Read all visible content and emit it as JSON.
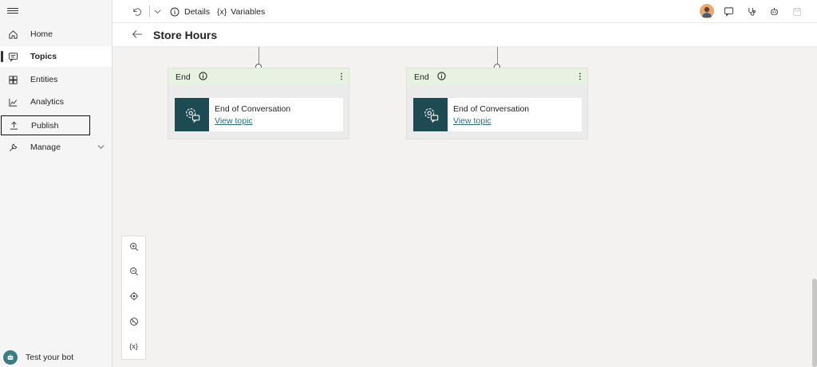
{
  "sidebar": {
    "items": [
      {
        "label": "Home",
        "icon": "home-icon"
      },
      {
        "label": "Topics",
        "icon": "chat-icon"
      },
      {
        "label": "Entities",
        "icon": "entities-icon"
      },
      {
        "label": "Analytics",
        "icon": "chart-icon"
      },
      {
        "label": "Publish",
        "icon": "upload-icon"
      },
      {
        "label": "Manage",
        "icon": "wrench-icon"
      }
    ],
    "test_bot_label": "Test your bot"
  },
  "toolbar": {
    "details_label": "Details",
    "variables_glyph": "{x}",
    "variables_label": "Variables"
  },
  "header": {
    "title": "Store Hours"
  },
  "nodes": [
    {
      "title": "End",
      "card_title": "End of Conversation",
      "card_link": "View topic"
    },
    {
      "title": "End",
      "card_title": "End of Conversation",
      "card_link": "View topic"
    }
  ],
  "zoom": {
    "variables_glyph": "{x}"
  },
  "colors": {
    "node_header": "#e8f2e3",
    "card_icon_bg": "#1e4a53",
    "link": "#2c6e78"
  }
}
